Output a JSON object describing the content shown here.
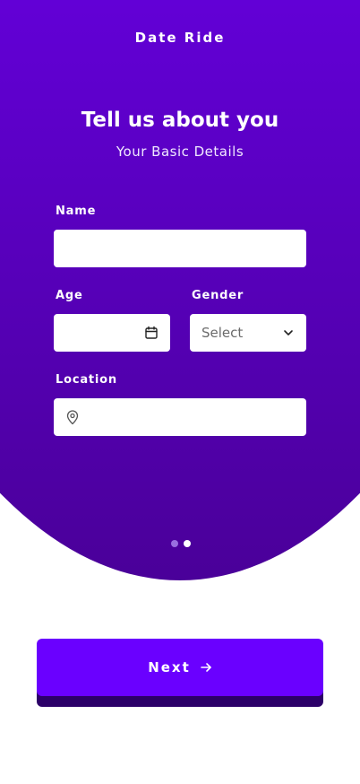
{
  "header": {
    "app_title": "Date Ride"
  },
  "intro": {
    "heading": "Tell us about you",
    "subheading": "Your Basic Details"
  },
  "form": {
    "name": {
      "label": "Name",
      "value": "",
      "placeholder": ""
    },
    "age": {
      "label": "Age",
      "value": "",
      "icon": "calendar-icon"
    },
    "gender": {
      "label": "Gender",
      "selected": "Select",
      "icon": "chevron-down-icon"
    },
    "location": {
      "label": "Location",
      "value": "",
      "icon": "map-pin-icon"
    }
  },
  "pagination": {
    "total": 2,
    "current": 2
  },
  "footer": {
    "next_label": "Next",
    "next_icon": "arrow-right-icon"
  },
  "colors": {
    "primary": "#6a00ff",
    "hero_top": "#6200d6",
    "hero_bottom": "#4a0099",
    "field_bg": "#ffffff",
    "button_shadow": "#2c0068"
  }
}
